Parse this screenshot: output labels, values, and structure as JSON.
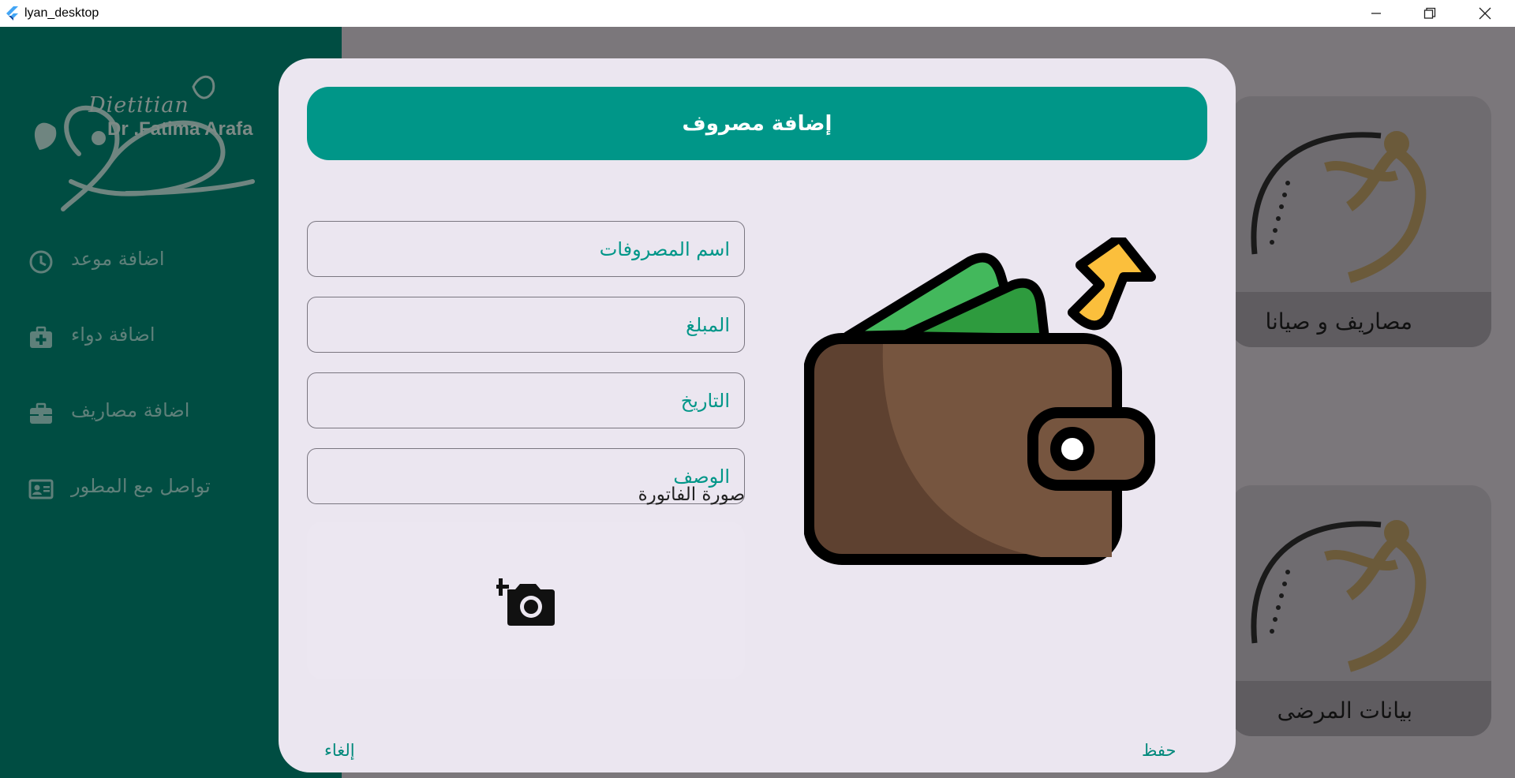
{
  "window": {
    "title": "lyan_desktop",
    "icon": "flutter-icon",
    "controls": [
      "minimize-icon",
      "restore-icon",
      "close-icon"
    ]
  },
  "sidebar": {
    "logo": {
      "line1": "Dietitian",
      "line2": "Dr .Fatima Arafa"
    },
    "items": [
      {
        "label": "اضافة موعد",
        "icon": "clock-icon"
      },
      {
        "label": "اضافة دواء",
        "icon": "medical-kit-icon"
      },
      {
        "label": "اضافة مصاريف",
        "icon": "briefcase-icon"
      },
      {
        "label": "تواصل مع المطور",
        "icon": "contact-card-icon"
      }
    ]
  },
  "background_cards": [
    {
      "label": "مصاريف و صيانا"
    },
    {
      "label": "بيانات المرضى"
    }
  ],
  "dialog": {
    "title": "إضافة مصروف",
    "fields": [
      {
        "placeholder": "اسم المصروفات"
      },
      {
        "placeholder": "المبلغ"
      },
      {
        "placeholder": "التاريخ"
      },
      {
        "placeholder": "الوصف"
      }
    ],
    "invoice_label": "صورة الفاتورة",
    "invoice_icon": "add-photo-icon",
    "illustration": "wallet-icon",
    "save_label": "حفظ",
    "cancel_label": "إلغاء"
  },
  "colors": {
    "sidebar": "#004d42",
    "accent": "#009688",
    "dialog_bg": "#ebe6f0",
    "overlay": "#7b777b"
  }
}
